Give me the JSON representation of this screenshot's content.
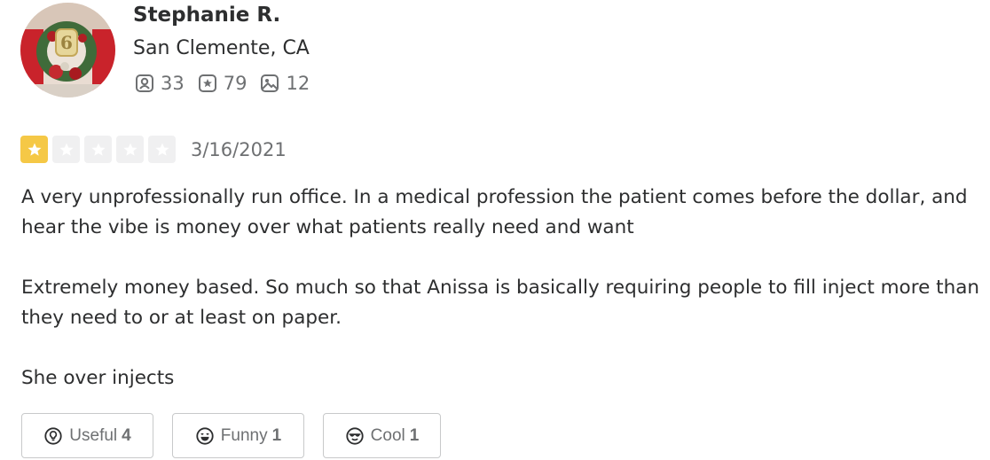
{
  "user": {
    "name": "Stephanie R.",
    "location": "San Clemente, CA",
    "stats": {
      "friends": "33",
      "reviews": "79",
      "photos": "12"
    },
    "avatar_icon": "avatar-photo-wreath"
  },
  "review": {
    "rating": 1,
    "rating_max": 5,
    "date": "3/16/2021",
    "text": "A very unprofessionally run office. In a medical profession the patient comes before the dollar, and hear the vibe is money over what patients really need and want\n\nExtremely money based. So much so that Anissa is basically requiring people to fill inject more than they need to or at least on paper.\n\nShe over injects"
  },
  "reactions": {
    "useful": {
      "label": "Useful",
      "count": "4"
    },
    "funny": {
      "label": "Funny",
      "count": "1"
    },
    "cool": {
      "label": "Cool",
      "count": "1"
    }
  },
  "colors": {
    "star_filled": "#f5c846",
    "star_empty": "#f0f0f1",
    "text": "#2d2e2f",
    "muted": "#6e7072"
  }
}
